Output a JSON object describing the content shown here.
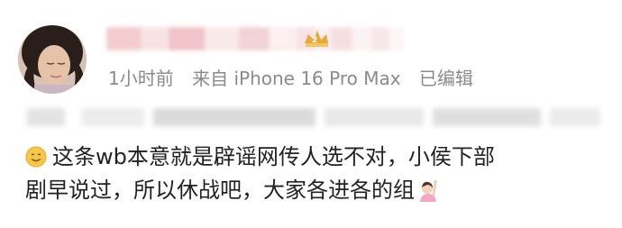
{
  "post": {
    "username": "",
    "meta": {
      "time": "1小时前",
      "source": "来自 iPhone 16 Pro Max",
      "edited": "已编辑"
    },
    "text_line1": "这条wb本意就是辟谣网传人选不对，小侯下部",
    "text_line2": "剧早说过，所以休战吧，大家各进各的组"
  },
  "icons": {
    "avatar": "user-avatar",
    "vip": "vip-badge-icon",
    "leading_emoji": "smile-emoji-icon",
    "trailing_emoji": "person-raising-hand-emoji-icon"
  },
  "colors": {
    "meta_text": "#8a8a8a",
    "body_text": "#222222",
    "vip_gold": "#e8a93a"
  }
}
